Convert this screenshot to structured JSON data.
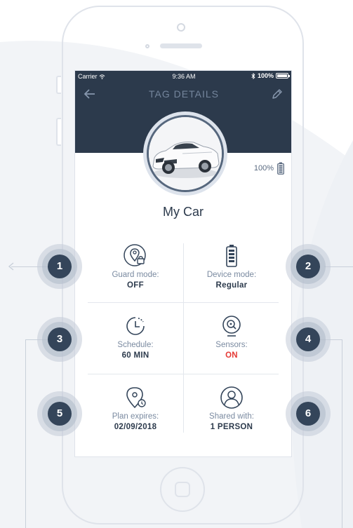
{
  "status_bar": {
    "carrier": "Carrier",
    "time": "9:36 AM",
    "battery": "100%"
  },
  "nav": {
    "title": "TAG DETAILS"
  },
  "tag": {
    "battery_label": "100%",
    "name": "My Car"
  },
  "cells": [
    {
      "label": "Guard mode:",
      "value": "OFF",
      "icon": "location-lock-icon"
    },
    {
      "label": "Device mode:",
      "value": "Regular",
      "icon": "battery-icon"
    },
    {
      "label": "Schedule:",
      "value": "60 MIN",
      "icon": "clock-icon"
    },
    {
      "label": "Sensors:",
      "value": "ON",
      "icon": "search-location-icon"
    },
    {
      "label": "Plan expires:",
      "value": "02/09/2018",
      "icon": "location-pin-icon"
    },
    {
      "label": "Shared with:",
      "value": "1 PERSON",
      "icon": "user-icon"
    }
  ],
  "callouts": [
    "1",
    "2",
    "3",
    "4",
    "5",
    "6"
  ],
  "colors": {
    "header": "#2c3a4c",
    "accent_on": "#e53935",
    "badge": "#34455a"
  }
}
